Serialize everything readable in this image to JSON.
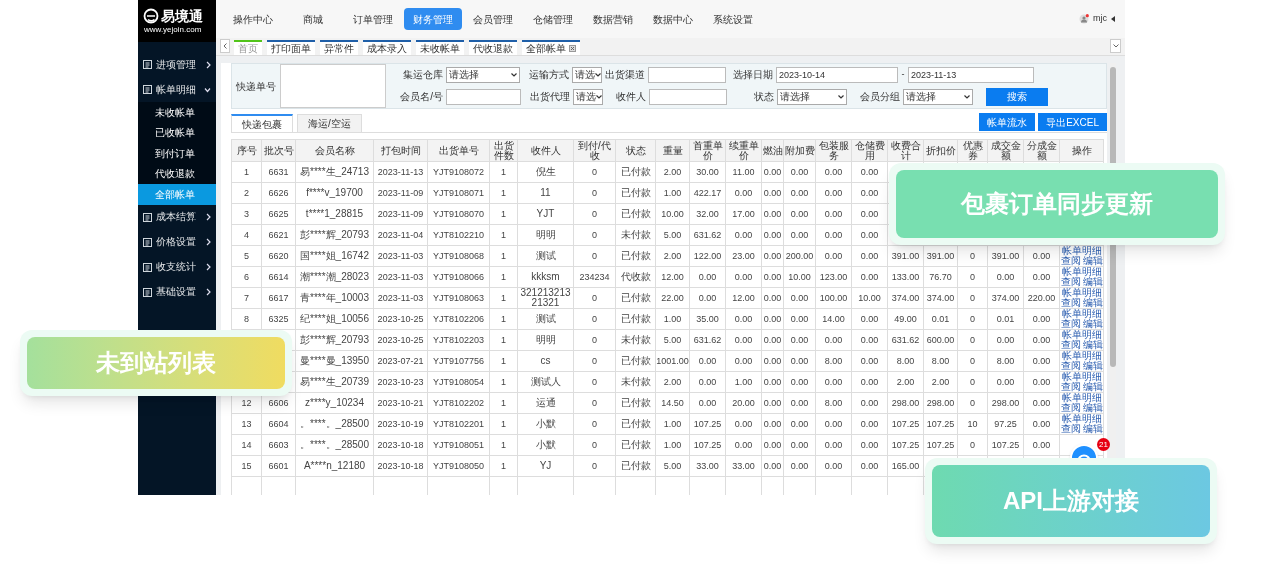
{
  "logo": {
    "name": "易境通",
    "url": "www.yejoin.com"
  },
  "top_nav": [
    {
      "label": "操作中心",
      "selected": false
    },
    {
      "label": "商城",
      "selected": false
    },
    {
      "label": "订单管理",
      "selected": false
    },
    {
      "label": "财务管理",
      "selected": true
    },
    {
      "label": "会员管理",
      "selected": false
    },
    {
      "label": "仓储管理",
      "selected": false
    },
    {
      "label": "数据营销",
      "selected": false
    },
    {
      "label": "数据中心",
      "selected": false
    },
    {
      "label": "系统设置",
      "selected": false
    }
  ],
  "user": {
    "name": "mjc"
  },
  "page_tabs": [
    {
      "label": "首页",
      "kind": "home",
      "closable": false
    },
    {
      "label": "打印面单",
      "kind": "page",
      "closable": false
    },
    {
      "label": "异常件",
      "kind": "page",
      "closable": false
    },
    {
      "label": "成本录入",
      "kind": "page",
      "closable": false
    },
    {
      "label": "未收帐单",
      "kind": "page",
      "closable": false
    },
    {
      "label": "代收退款",
      "kind": "page",
      "closable": false
    },
    {
      "label": "全部帐单",
      "kind": "page",
      "closable": true
    }
  ],
  "sidebar": {
    "items": [
      {
        "label": "进项管理",
        "expanded": false
      },
      {
        "label": "帐单明细",
        "expanded": true,
        "children": [
          {
            "label": "未收帐单",
            "selected": false
          },
          {
            "label": "已收帐单",
            "selected": false
          },
          {
            "label": "到付订单",
            "selected": false
          },
          {
            "label": "代收退款",
            "selected": false
          },
          {
            "label": "全部帐单",
            "selected": true
          }
        ]
      },
      {
        "label": "成本结算",
        "expanded": false
      },
      {
        "label": "价格设置",
        "expanded": false
      },
      {
        "label": "收支统计",
        "expanded": false
      },
      {
        "label": "基础设置",
        "expanded": false
      }
    ]
  },
  "filters": {
    "order_no": {
      "label": "快递单号"
    },
    "rows": [
      [
        {
          "kind": "select",
          "label": "集运仓库",
          "value": "请选择"
        },
        {
          "kind": "select",
          "label": "运输方式",
          "value": "请选"
        },
        {
          "kind": "input",
          "label": "出货渠道"
        },
        {
          "kind": "date_range",
          "label": "选择日期",
          "from": "2023-10-14",
          "separator": "-",
          "to": "2023-11-13"
        }
      ],
      [
        {
          "kind": "input",
          "label": "会员名/号"
        },
        {
          "kind": "select",
          "label": "出货代理",
          "value": "请选"
        },
        {
          "kind": "input",
          "label": "收件人"
        },
        {
          "kind": "select",
          "label": "状态",
          "value": "请选择"
        },
        {
          "kind": "select",
          "label": "会员分组",
          "value": "请选择"
        }
      ]
    ],
    "search_button": "搜索"
  },
  "result_tabs": [
    {
      "label": "快递包裹",
      "selected": true
    },
    {
      "label": "海运/空运",
      "selected": false
    }
  ],
  "toolbar_buttons": [
    "帐单流水",
    "导出EXCEL"
  ],
  "table": {
    "columns": [
      "序号",
      "批次号",
      "会员名称",
      "打包时间",
      "出货单号",
      "出货件数",
      "收件人",
      "到付/代收",
      "状态",
      "重量",
      "首重单价",
      "续重单价",
      "燃油",
      "附加费",
      "包装服务",
      "仓储费用",
      "收费合计",
      "折扣价",
      "优惠券",
      "成交金额",
      "分成金额",
      "操作"
    ],
    "rows": [
      {
        "cells": [
          "1",
          "6631",
          "易****生_24713",
          "2023-11-13",
          "YJT9108072",
          "1",
          "倪生",
          "0",
          "已付款",
          "2.00",
          "30.00",
          "11.00",
          "0.00",
          "0.00",
          "0.00",
          "0.00",
          null,
          null,
          null,
          null,
          null
        ]
      },
      {
        "cells": [
          "2",
          "6626",
          "f****v_19700",
          "2023-11-09",
          "YJT9108071",
          "1",
          "11",
          "0",
          "已付款",
          "1.00",
          "422.17",
          "0.00",
          "0.00",
          "0.00",
          "0.00",
          "0.00",
          null,
          null,
          null,
          null,
          null
        ]
      },
      {
        "cells": [
          "3",
          "6625",
          "t****1_28815",
          "2023-11-09",
          "YJT9108070",
          "1",
          "YJT",
          "0",
          "已付款",
          "10.00",
          "32.00",
          "17.00",
          "0.00",
          "0.00",
          "0.00",
          "0.00",
          null,
          null,
          null,
          null,
          null
        ]
      },
      {
        "cells": [
          "4",
          "6621",
          "彭****辉_20793",
          "2023-11-04",
          "YJT8102210",
          "1",
          "明明",
          "0",
          "未付款",
          "5.00",
          "631.62",
          "0.00",
          "0.00",
          "0.00",
          "0.00",
          "0.00",
          null,
          null,
          null,
          null,
          null
        ]
      },
      {
        "cells": [
          "5",
          "6620",
          "国****姐_16742",
          "2023-11-03",
          "YJT9108068",
          "1",
          "测试",
          "0",
          "已付款",
          "2.00",
          "122.00",
          "23.00",
          "0.00",
          "200.00",
          "0.00",
          "0.00",
          "391.00",
          "391.00",
          "0",
          "391.00",
          "0.00"
        ],
        "actions": [
          "帐单明细",
          "查阅",
          "编辑"
        ]
      },
      {
        "cells": [
          "6",
          "6614",
          "潮****潮_28023",
          "2023-11-03",
          "YJT9108066",
          "1",
          "kkksm",
          "234234",
          "代收款",
          "12.00",
          "0.00",
          "0.00",
          "0.00",
          "10.00",
          "123.00",
          "0.00",
          "133.00",
          "76.70",
          "0",
          "0.00",
          "0.00"
        ],
        "actions": [
          "帐单明细",
          "查阅",
          "编辑"
        ]
      },
      {
        "cells": [
          "7",
          "6617",
          "青****年_10003",
          "2023-11-03",
          "YJT9108063",
          "1",
          "32121321321321",
          "0",
          "已付款",
          "22.00",
          "0.00",
          "12.00",
          "0.00",
          "0.00",
          "100.00",
          "10.00",
          "374.00",
          "374.00",
          "0",
          "374.00",
          "220.00"
        ],
        "actions": [
          "帐单明细",
          "查阅",
          "编辑"
        ]
      },
      {
        "cells": [
          "8",
          "6325",
          "纪****姐_10056",
          "2023-10-25",
          "YJT8102206",
          "1",
          "测试",
          "0",
          "已付款",
          "1.00",
          "35.00",
          "0.00",
          "0.00",
          "0.00",
          "14.00",
          "0.00",
          "49.00",
          "0.01",
          "0",
          "0.01",
          "0.00"
        ],
        "actions": [
          "帐单明细",
          "查阅",
          "编辑"
        ]
      },
      {
        "cells": [
          null,
          null,
          "彭****辉_20793",
          "2023-10-25",
          "YJT8102203",
          "1",
          "明明",
          "0",
          "未付款",
          "5.00",
          "631.62",
          "0.00",
          "0.00",
          "0.00",
          "0.00",
          "0.00",
          "631.62",
          "600.00",
          "0",
          "0.00",
          "0.00"
        ],
        "actions": [
          "帐单明细",
          "查阅",
          "编辑"
        ]
      },
      {
        "cells": [
          null,
          null,
          "曼****曼_13950",
          "2023-07-21",
          "YJT9107756",
          "1",
          "cs",
          "0",
          "已付款",
          "1001.00",
          "0.00",
          "0.00",
          "0.00",
          "0.00",
          "8.00",
          "0.00",
          "8.00",
          "8.00",
          "0",
          "8.00",
          "0.00"
        ],
        "actions": [
          "帐单明细",
          "查阅",
          "编辑"
        ]
      },
      {
        "cells": [
          null,
          null,
          "易****生_20739",
          "2023-10-23",
          "YJT9108054",
          "1",
          "测试人",
          "0",
          "未付款",
          "2.00",
          "0.00",
          "1.00",
          "0.00",
          "0.00",
          "0.00",
          "0.00",
          "2.00",
          "2.00",
          "0",
          "0.00",
          "0.00"
        ],
        "actions": [
          "帐单明细",
          "查阅",
          "编辑"
        ]
      },
      {
        "cells": [
          "12",
          "6606",
          "z****y_10234",
          "2023-10-21",
          "YJT8102202",
          "1",
          "运通",
          "0",
          "已付款",
          "14.50",
          "0.00",
          "20.00",
          "0.00",
          "0.00",
          "8.00",
          "0.00",
          "298.00",
          "298.00",
          "0",
          "298.00",
          "0.00"
        ],
        "actions": [
          "帐单明细",
          "查阅",
          "编辑"
        ]
      },
      {
        "cells": [
          "13",
          "6604",
          "。****。_28500",
          "2023-10-19",
          "YJT8102201",
          "1",
          "小默",
          "0",
          "已付款",
          "1.00",
          "107.25",
          "0.00",
          "0.00",
          "0.00",
          "0.00",
          "0.00",
          "107.25",
          "107.25",
          "10",
          "97.25",
          "0.00"
        ],
        "actions": [
          "帐单明细",
          "查阅",
          "编辑"
        ]
      },
      {
        "cells": [
          "14",
          "6603",
          "。****。_28500",
          "2023-10-18",
          "YJT9108051",
          "1",
          "小默",
          "0",
          "已付款",
          "1.00",
          "107.25",
          "0.00",
          "0.00",
          "0.00",
          "0.00",
          "0.00",
          "107.25",
          "107.25",
          "0",
          "107.25",
          "0.00"
        ]
      },
      {
        "cells": [
          "15",
          "6601",
          "A****n_12180",
          "2023-10-18",
          "YJT9108050",
          "1",
          "YJ",
          "0",
          "已付款",
          "5.00",
          "33.00",
          "33.00",
          "0.00",
          "0.00",
          "0.00",
          "0.00",
          "165.00",
          null,
          null,
          null,
          null
        ]
      }
    ]
  },
  "chat_button": {
    "badge": "21"
  },
  "callouts": [
    {
      "text": "包裹订单同步更新",
      "kind": "mint"
    },
    {
      "text": "未到站列表",
      "kind": "lime"
    },
    {
      "text": "API上游对接",
      "kind": "teal"
    }
  ]
}
